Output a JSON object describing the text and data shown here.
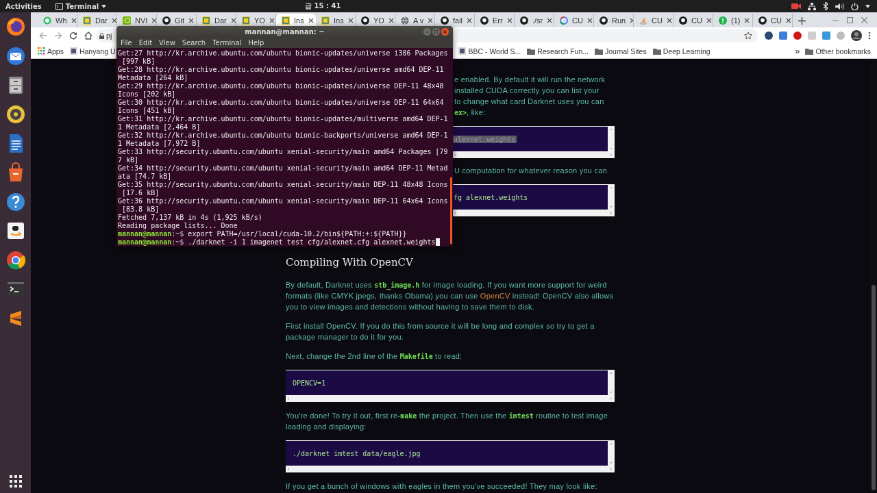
{
  "topbar": {
    "activities": "Activities",
    "app_menu": "Terminal",
    "clock": "금 15 : 41"
  },
  "dock": [
    {
      "kind": "firefox"
    },
    {
      "kind": "mail"
    },
    {
      "kind": "files"
    },
    {
      "kind": "music"
    },
    {
      "kind": "document"
    },
    {
      "kind": "store"
    },
    {
      "kind": "help"
    },
    {
      "kind": "amazon"
    },
    {
      "kind": "chrome"
    },
    {
      "kind": "terminal"
    },
    {
      "kind": "sublime"
    }
  ],
  "browser": {
    "tabs": [
      {
        "title": "Wh",
        "kind": "chat",
        "selected": false
      },
      {
        "title": "Dar",
        "kind": "pjr",
        "selected": false
      },
      {
        "title": "NVI",
        "kind": "nvidia",
        "selected": false
      },
      {
        "title": "Git",
        "kind": "github",
        "selected": false
      },
      {
        "title": "Dar",
        "kind": "pjr",
        "selected": false
      },
      {
        "title": "YO",
        "kind": "pjr",
        "selected": false
      },
      {
        "title": "Ins",
        "kind": "pjr",
        "selected": true
      },
      {
        "title": "Ins",
        "kind": "pjr",
        "selected": false
      },
      {
        "title": "YO",
        "kind": "github",
        "selected": false
      },
      {
        "title": "A v",
        "kind": "globe",
        "selected": false
      },
      {
        "title": "fail",
        "kind": "github",
        "selected": false
      },
      {
        "title": "Err",
        "kind": "github",
        "selected": false
      },
      {
        "title": "./sr",
        "kind": "github",
        "selected": false
      },
      {
        "title": "CU",
        "kind": "google",
        "selected": false
      },
      {
        "title": "Run",
        "kind": "github",
        "selected": false
      },
      {
        "title": "CU",
        "kind": "stack",
        "selected": false
      },
      {
        "title": "CU",
        "kind": "github",
        "selected": false
      },
      {
        "title": "(1)",
        "kind": "notice",
        "selected": false
      },
      {
        "title": "CU",
        "kind": "github",
        "selected": false
      }
    ],
    "address": "pj",
    "bookmarks_left": [
      {
        "kind": "apps",
        "label": "Apps"
      },
      {
        "kind": "site",
        "label": "Hanyang U"
      }
    ],
    "bookmarks_right": [
      {
        "kind": "site",
        "label": "BBC - World S..."
      },
      {
        "kind": "folder",
        "label": "Research Fun..."
      },
      {
        "kind": "folder",
        "label": "Journal Sites"
      },
      {
        "kind": "folder",
        "label": "Deep Learning"
      }
    ],
    "more_bookmarks": "»",
    "other_bookmarks": "Other bookmarks"
  },
  "page": {
    "blocks": [
      {
        "kind": "partial",
        "lines": [
          [
            {
              "kind": "text",
              "text": "e enabled. By default it will run the network"
            }
          ],
          [
            {
              "kind": "text",
              "text": "installed CUDA correctly you can list your"
            }
          ],
          [
            {
              "kind": "text",
              "text": "to change what card Darknet uses you can"
            }
          ],
          [
            {
              "kind": "code",
              "text": "ex>"
            },
            {
              "kind": "text",
              "text": ", like:"
            }
          ]
        ]
      },
      {
        "kind": "code",
        "partial": true,
        "highlighted": true,
        "text": "alexnet.weights"
      },
      {
        "kind": "partial",
        "lines": [
          [
            {
              "kind": "text",
              "text": "U computation for whatever reason you can"
            }
          ]
        ]
      },
      {
        "kind": "code",
        "partial": true,
        "highlighted": false,
        "text": "fg alexnet.weights"
      },
      {
        "kind": "heading",
        "text": "Compiling With OpenCV"
      },
      {
        "kind": "paragraph",
        "segments": [
          {
            "kind": "text",
            "text": "By default, Darknet uses "
          },
          {
            "kind": "code",
            "text": "stb_image.h"
          },
          {
            "kind": "text",
            "text": " for image loading. If you want more support for weird formats (like CMYK jpegs, thanks Obama) you can use "
          },
          {
            "kind": "link",
            "text": "OpenCV"
          },
          {
            "kind": "text",
            "text": " instead! OpenCV also allows you to view images and detections without having to save them to disk."
          }
        ]
      },
      {
        "kind": "paragraph",
        "segments": [
          {
            "kind": "text",
            "text": "First install OpenCV. If you do this from source it will be long and complex so try to get a package manager to do it for you."
          }
        ]
      },
      {
        "kind": "paragraph",
        "segments": [
          {
            "kind": "text",
            "text": "Next, change the 2nd line of the "
          },
          {
            "kind": "code",
            "text": "Makefile"
          },
          {
            "kind": "text",
            "text": " to read:"
          }
        ]
      },
      {
        "kind": "code",
        "partial": false,
        "highlighted": false,
        "text": "OPENCV=1"
      },
      {
        "kind": "paragraph",
        "segments": [
          {
            "kind": "text",
            "text": "You're done! To try it out, first re-"
          },
          {
            "kind": "code",
            "text": "make"
          },
          {
            "kind": "text",
            "text": " the project. Then use the "
          },
          {
            "kind": "code",
            "text": "imtest"
          },
          {
            "kind": "text",
            "text": " routine to test image loading and displaying:"
          }
        ]
      },
      {
        "kind": "code",
        "partial": false,
        "highlighted": false,
        "text": "./darknet imtest data/eagle.jpg"
      },
      {
        "kind": "paragraph",
        "segments": [
          {
            "kind": "text",
            "text": "If you get a bunch of windows with eagles in them you've succeeded! They may look like:"
          }
        ]
      }
    ]
  },
  "terminal": {
    "title": "mannan@mannan: ~",
    "menu": [
      "File",
      "Edit",
      "View",
      "Search",
      "Terminal",
      "Help"
    ],
    "lines": [
      {
        "kind": "output",
        "text": "Get:27 http://kr.archive.ubuntu.com/ubuntu bionic-updates/universe i386 Packages"
      },
      {
        "kind": "output",
        "text": " [997 kB]"
      },
      {
        "kind": "output",
        "text": "Get:28 http://kr.archive.ubuntu.com/ubuntu bionic-updates/universe amd64 DEP-11"
      },
      {
        "kind": "output",
        "text": "Metadata [264 kB]"
      },
      {
        "kind": "output",
        "text": "Get:29 http://kr.archive.ubuntu.com/ubuntu bionic-updates/universe DEP-11 48x48"
      },
      {
        "kind": "output",
        "text": "Icons [202 kB]"
      },
      {
        "kind": "output",
        "text": "Get:30 http://kr.archive.ubuntu.com/ubuntu bionic-updates/universe DEP-11 64x64"
      },
      {
        "kind": "output",
        "text": "Icons [451 kB]"
      },
      {
        "kind": "output",
        "text": "Get:31 http://kr.archive.ubuntu.com/ubuntu bionic-updates/multiverse amd64 DEP-1"
      },
      {
        "kind": "output",
        "text": "1 Metadata [2,464 B]"
      },
      {
        "kind": "output",
        "text": "Get:32 http://kr.archive.ubuntu.com/ubuntu bionic-backports/universe amd64 DEP-1"
      },
      {
        "kind": "output",
        "text": "1 Metadata [7,972 B]"
      },
      {
        "kind": "output",
        "text": "Get:33 http://security.ubuntu.com/ubuntu xenial-security/main amd64 Packages [79"
      },
      {
        "kind": "output",
        "text": "7 kB]"
      },
      {
        "kind": "output",
        "text": "Get:34 http://security.ubuntu.com/ubuntu xenial-security/main amd64 DEP-11 Metad"
      },
      {
        "kind": "output",
        "text": "ata [74.7 kB]"
      },
      {
        "kind": "output",
        "text": "Get:35 http://security.ubuntu.com/ubuntu xenial-security/main DEP-11 48x48 Icons"
      },
      {
        "kind": "output",
        "text": " [17.6 kB]"
      },
      {
        "kind": "output",
        "text": "Get:36 http://security.ubuntu.com/ubuntu xenial-security/main DEP-11 64x64 Icons"
      },
      {
        "kind": "output",
        "text": " [83.8 kB]"
      },
      {
        "kind": "output",
        "text": "Fetched 7,137 kB in 4s (1,925 kB/s)"
      },
      {
        "kind": "output",
        "text": "Reading package lists... Done"
      },
      {
        "kind": "prompt",
        "user": "mannan@mannan",
        "path": ":~$",
        "command": "export PATH=/usr/local/cuda-10.2/bin${PATH:+:${PATH}}",
        "cursor": false
      },
      {
        "kind": "prompt",
        "user": "mannan@mannan",
        "path": ":~$",
        "command": "./darknet -i 1 imagenet test cfg/alexnet.cfg alexnet.weights",
        "cursor": true
      }
    ]
  }
}
